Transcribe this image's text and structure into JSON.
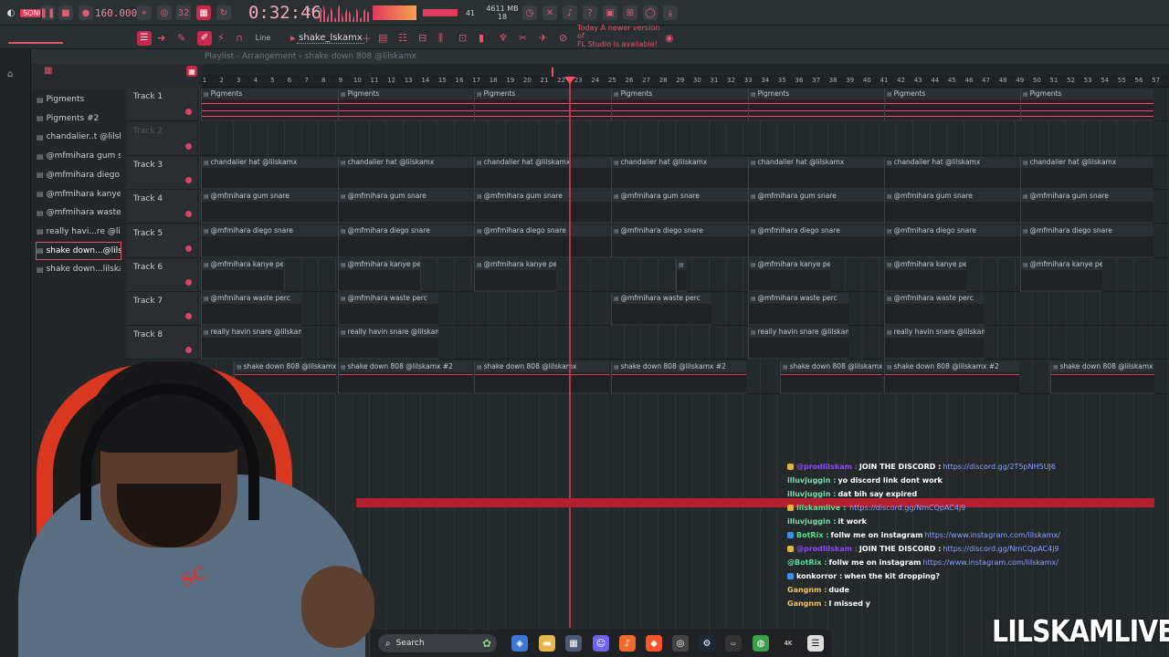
{
  "transport": {
    "song_label": "SONG",
    "bpm": "160.000",
    "time": "0:32:46",
    "time_unit": "M:S:CS",
    "cpu_voices": "41",
    "memory": "4611 MB",
    "cpu_count": "18"
  },
  "toolbar2": {
    "snap_label": "Line",
    "pattern_name": "shake_lskamx",
    "news_line1": "Today  A newer version of",
    "news_line2": "FL Studio is available!"
  },
  "playlist": {
    "title": "Playlist - Arrangement › shake down 808 @lilskamx"
  },
  "ruler_marks": [
    "1",
    "2",
    "3",
    "4",
    "5",
    "6",
    "7",
    "8",
    "9",
    "10",
    "11",
    "12",
    "13",
    "14",
    "15",
    "16",
    "17",
    "18",
    "19",
    "20",
    "21",
    "22",
    "23",
    "24",
    "25",
    "26",
    "27",
    "28",
    "29",
    "30",
    "31",
    "32",
    "33",
    "34",
    "35",
    "36",
    "37",
    "38",
    "39",
    "40",
    "41",
    "42",
    "43",
    "44",
    "45",
    "46",
    "47",
    "48",
    "49",
    "50",
    "51",
    "52",
    "53",
    "54",
    "55",
    "56",
    "57"
  ],
  "patterns": [
    {
      "name": "Pigments"
    },
    {
      "name": "Pigments #2"
    },
    {
      "name": "chandalier..t @lilskamx"
    },
    {
      "name": "@mfmihara gum snare"
    },
    {
      "name": "@mfmihara diego snare"
    },
    {
      "name": "@mfmihara kanye perc"
    },
    {
      "name": "@mfmihara waste perc"
    },
    {
      "name": "really havi...re @lilskamx"
    },
    {
      "name": "shake down...@lilskamx"
    },
    {
      "name": "shake down...lilskamx #2"
    }
  ],
  "tracks": [
    {
      "label": "Track 1"
    },
    {
      "label": "Track 2"
    },
    {
      "label": "Track 3"
    },
    {
      "label": "Track 4"
    },
    {
      "label": "Track 5"
    },
    {
      "label": "Track 6"
    },
    {
      "label": "Track 7"
    },
    {
      "label": "Track 8"
    }
  ],
  "clips": {
    "pigments": "Pigments",
    "chandalier": "chandalier hat @lilskamx",
    "gum": "@mfmihara gum snare",
    "diego": "@mfmihara diego snare",
    "kanye": "@mfmihara kanye perc",
    "waste": "@mfmihara waste perc",
    "havin": "really havin snare @lilskamx",
    "shake1": "shake down 808 @lilskamx",
    "shake2": "shake down 808 @lilskamx #2"
  },
  "chat": [
    {
      "user": "@prodlilskam",
      "text": "JOIN THE DISCORD :",
      "link": "https://discord.gg/2T5pNH5UJ6",
      "user_color": "#9146ff",
      "badge": "#e3b341"
    },
    {
      "user": "illuvjuggin",
      "text": "yo discord link dont work",
      "link": "",
      "user_color": "#7fd8a8",
      "badge": ""
    },
    {
      "user": "illuvjuggin",
      "text": "dat bih say expired",
      "link": "",
      "user_color": "#7fd8a8",
      "badge": ""
    },
    {
      "user": "lilskamlive",
      "text": "",
      "link": "https://discord.gg/NmCQpAC4j9",
      "user_color": "#55e08c",
      "badge": "#e3b341"
    },
    {
      "user": "illuvjuggin",
      "text": "it work",
      "link": "",
      "user_color": "#7fd8a8",
      "badge": ""
    },
    {
      "user": "BotRix",
      "text": "follw me on instagram",
      "link": "https://www.instagram.com/lilskamx/",
      "user_color": "#55e08c",
      "badge": "#3b8eea"
    },
    {
      "user": "@prodlilskam",
      "text": "JOIN THE DISCORD :",
      "link": "https://discord.gg/NmCQpAC4j9",
      "user_color": "#9146ff",
      "badge": "#e3b341"
    },
    {
      "user": "@BotRix",
      "text": "follw me on instagram",
      "link": "https://www.instagram.com/lilskamx/",
      "user_color": "#55e08c",
      "badge": ""
    },
    {
      "user": "konkorror",
      "text": "when the kit dropping?",
      "link": "",
      "user_color": "#ffffff",
      "badge": "#3b8eea"
    },
    {
      "user": "Gangnm",
      "text": "dude",
      "link": "",
      "user_color": "#f0c060",
      "badge": ""
    },
    {
      "user": "Gangnm",
      "text": "I missed y",
      "link": "",
      "user_color": "#f0c060",
      "badge": ""
    }
  ],
  "taskbar": {
    "search_label": "Search"
  },
  "webcam": {
    "shirt_print": "SC"
  },
  "brand": "LILSKAMLIVE",
  "colors": {
    "accent": "#e0536f",
    "playhead": "#d8324f"
  }
}
